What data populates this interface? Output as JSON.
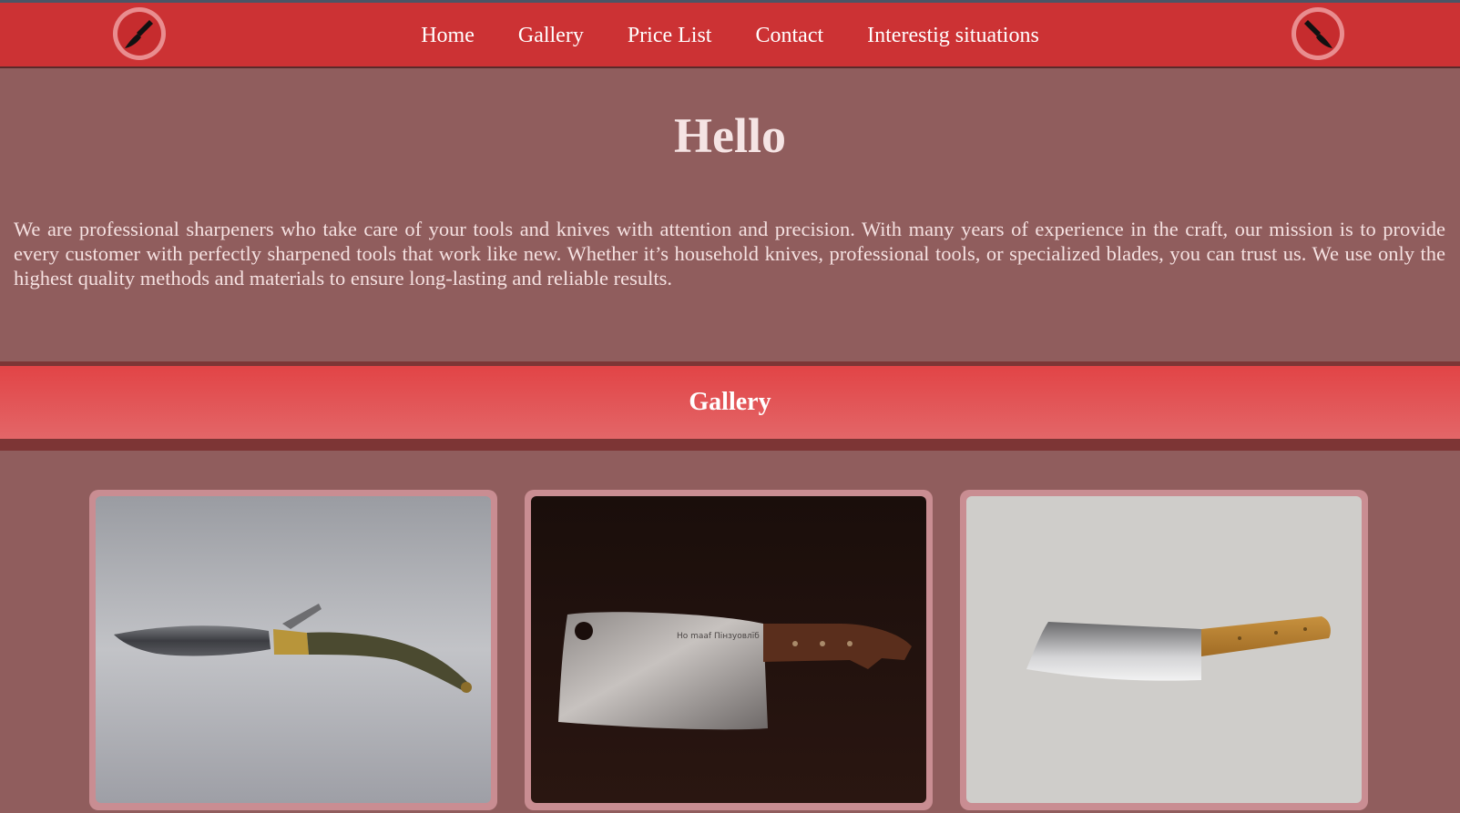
{
  "nav": {
    "links": [
      "Home",
      "Gallery",
      "Price List",
      "Contact",
      "Interestig situations"
    ],
    "logo_icon": "knife-icon",
    "colors": {
      "bar": "#cc3234",
      "logo_ring": "#e98d8f"
    }
  },
  "hero": {
    "title": "Hello",
    "text": "We are professional sharpeners who take care of your tools and knives with attention and precision. With many years of experience in the craft, our mission is to provide every customer with perfectly sharpened tools that work like new. Whether it’s household knives, professional tools, or specialized blades, you can trust us. We use only the highest quality methods and materials to ensure long-lasting and reliable results."
  },
  "gallery": {
    "title": "Gallery",
    "items": [
      {
        "icon": "folding-knife-photo"
      },
      {
        "icon": "cleaver-photo",
        "engraving": "Ho maaf Пінзуовлїб"
      },
      {
        "icon": "chopper-knife-photo"
      }
    ]
  },
  "colors": {
    "background": "#905d5d",
    "band": "#e24446",
    "text_light": "#f5e4e4"
  }
}
